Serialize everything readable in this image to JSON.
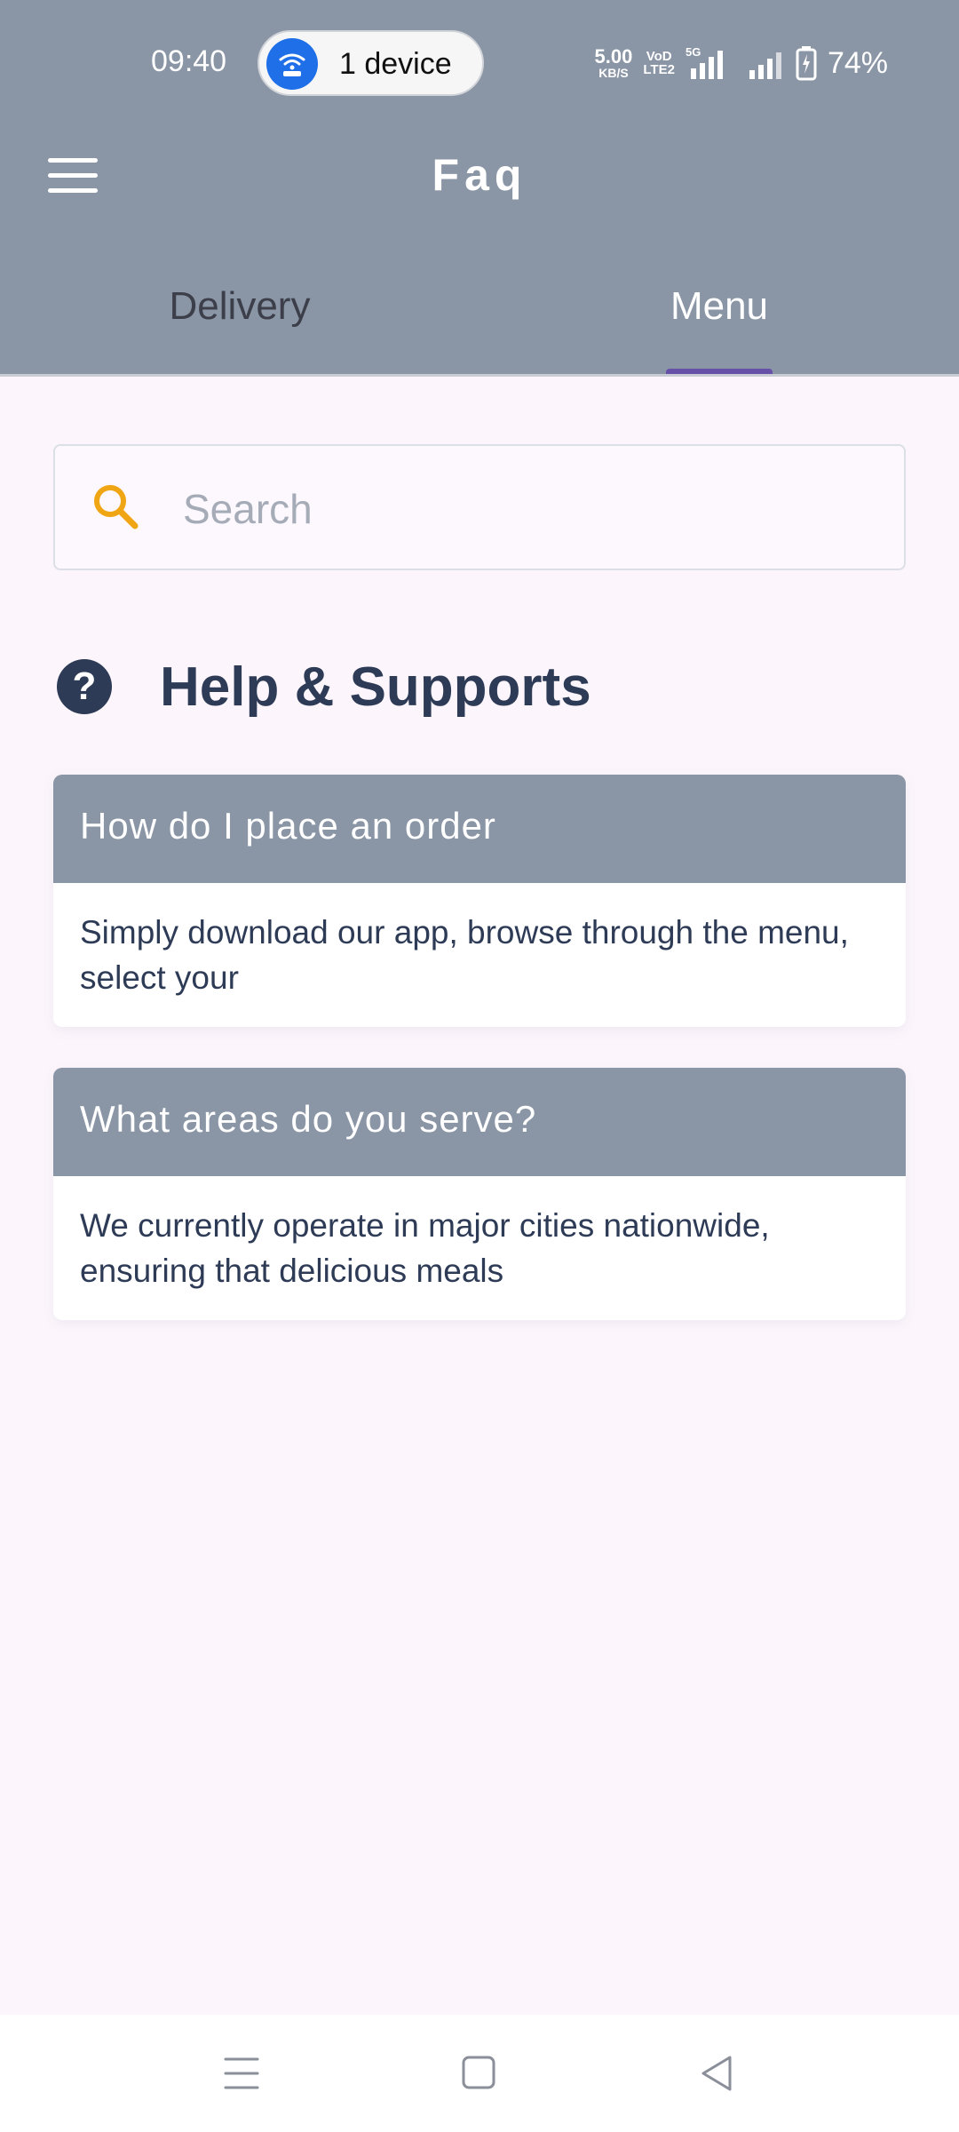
{
  "status_bar": {
    "time": "09:40",
    "hotspot_label": "1 device",
    "net_speed_value": "5.00",
    "net_speed_unit": "KB/S",
    "volte_top": "VoD",
    "volte_bottom": "LTE2",
    "network_type": "5G",
    "battery": "74%"
  },
  "app_bar": {
    "title": "Faq"
  },
  "tabs": [
    {
      "label": "Delivery",
      "selected": false
    },
    {
      "label": "Menu",
      "selected": true
    }
  ],
  "search": {
    "value": "",
    "placeholder": "Search"
  },
  "help": {
    "title": "Help & Supports"
  },
  "faqs": [
    {
      "question": "How do I place an order",
      "answer": "Simply download our app, browse through the menu, select your"
    },
    {
      "question": "What areas do you serve?",
      "answer": "We currently operate in major cities nationwide, ensuring that delicious meals"
    }
  ],
  "colors": {
    "header": "#8a95a5",
    "tab_indicator": "#6650a8",
    "background": "#fcf6fc",
    "text_dark": "#2e3b56",
    "search_icon": "#f0a514"
  }
}
